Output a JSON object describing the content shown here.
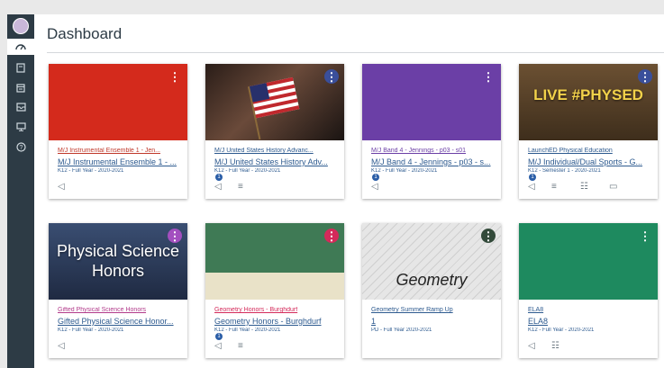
{
  "page_title": "Dashboard",
  "nav": [
    {
      "icon": "account-icon"
    },
    {
      "icon": "dashboard-icon"
    },
    {
      "icon": "courses-icon"
    },
    {
      "icon": "calendar-icon"
    },
    {
      "icon": "inbox-icon"
    },
    {
      "icon": "commons-icon"
    },
    {
      "icon": "help-icon"
    }
  ],
  "cards": [
    {
      "short": "M/J Instrumental Ensemble 1 - Jen...",
      "name": "M/J Instrumental Ensemble 1 - ...",
      "term": "K12 - Full Year - 2020-2021",
      "color": "#d42a1c",
      "short_color": "#c0392b",
      "hero_text": "",
      "icons": [
        "announcement-icon"
      ],
      "badge": ""
    },
    {
      "short": "M/J United States History Advanc...",
      "name": "M/J United States History Adv...",
      "term": "K12 - Full Year - 2020-2021",
      "color": "#3a2a22",
      "short_color": "#2d5a8f",
      "hero_text": "",
      "icons": [
        "announcement-icon",
        "assignments-icon"
      ],
      "badge": "1"
    },
    {
      "short": "M/J Band 4 - Jennings - p03 - s01",
      "name": "M/J Band 4 - Jennings - p03 - s...",
      "term": "K12 - Full Year - 2020-2021",
      "color": "#6b3fa6",
      "short_color": "#6b3fa6",
      "hero_text": "",
      "icons": [
        "announcement-icon"
      ],
      "badge": "1"
    },
    {
      "short": "LaunchED Physical Education",
      "name": "M/J Individual/Dual Sports - G...",
      "term": "K12 - Semester 1 - 2020-2021",
      "color": "#5a4630",
      "short_color": "#2d5a8f",
      "hero_text": "LIVE #PHYSED",
      "icons": [
        "announcement-icon",
        "assignments-icon",
        "discussions-icon",
        "files-icon"
      ],
      "badge": "1"
    },
    {
      "short": "Gifted Physical Science Honors",
      "name": "Gifted Physical Science Honor...",
      "term": "K12 - Full Year - 2020-2021",
      "color": "#2a3a58",
      "short_color": "#b23a8a",
      "hero_text": "Physical Science Honors",
      "icons": [
        "announcement-icon"
      ],
      "badge": ""
    },
    {
      "short": "Geometry Honors - Burghdurf",
      "name": "Geometry Honors - Burghdurf",
      "term": "K12 - Full Year - 2020-2021",
      "color": "#3d6e4e",
      "short_color": "#d42a5a",
      "hero_text": "",
      "icons": [
        "announcement-icon",
        "assignments-icon"
      ],
      "badge": "1"
    },
    {
      "short": "Geometry Summer Ramp Up",
      "name": "1",
      "term": "PD - Full Year 2020-2021",
      "color": "#dcdcdc",
      "short_color": "#2d5a8f",
      "hero_text": "Geometry",
      "icons": [],
      "badge": ""
    },
    {
      "short": "ELA8",
      "name": "ELA8",
      "term": "K12 - Full Year - 2020-2021",
      "color": "#1e8a5f",
      "short_color": "#2d5a8f",
      "hero_text": "",
      "icons": [
        "announcement-icon",
        "discussions-icon"
      ],
      "badge": ""
    }
  ]
}
